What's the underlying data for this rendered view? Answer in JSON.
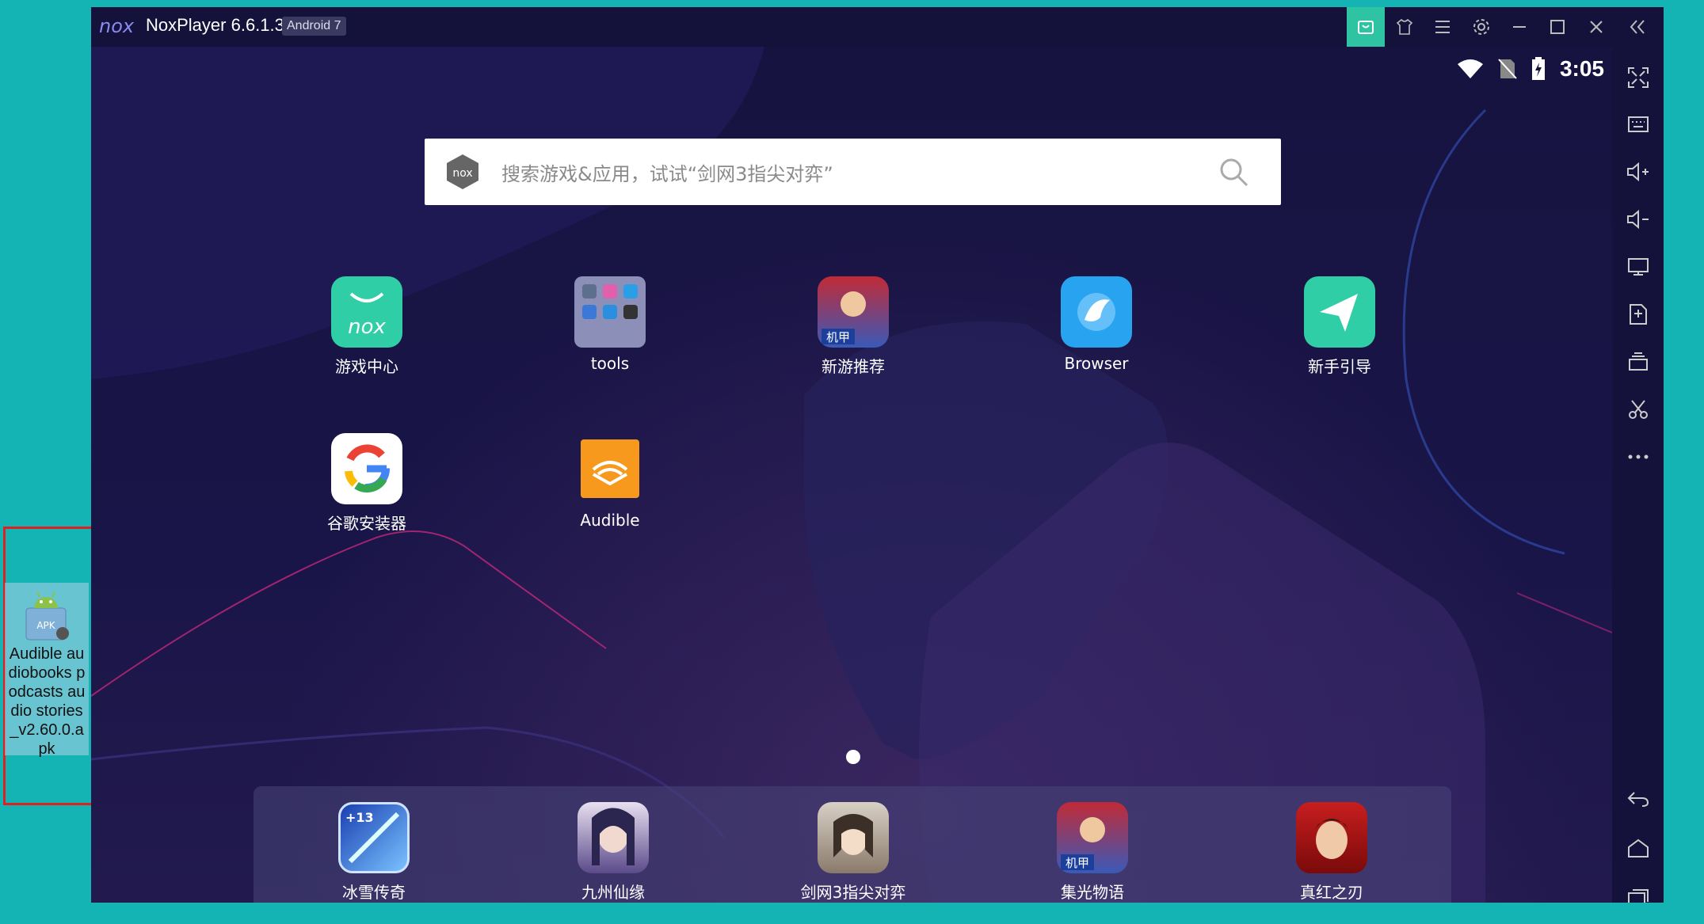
{
  "desktop": {
    "apk_file": {
      "icon": "apk-file-icon",
      "name": "Audible audiobooks podcasts audio stories_v2.60.0.apk"
    }
  },
  "window": {
    "title": "NoxPlayer 6.6.1.3",
    "android_badge": "Android 7",
    "title_buttons": [
      "store-icon",
      "home-icon",
      "menu-icon",
      "settings-icon",
      "minimize-icon",
      "maximize-icon",
      "close-icon",
      "collapse-icon"
    ]
  },
  "status_bar": {
    "time": "3:05"
  },
  "search": {
    "placeholder": "搜索游戏&应用，试试“剑网3指尖对弈”"
  },
  "apps": [
    {
      "label": "游戏中心"
    },
    {
      "label": "tools"
    },
    {
      "label": "新游推荐"
    },
    {
      "label": "Browser"
    },
    {
      "label": "新手引导"
    },
    {
      "label": "谷歌安装器"
    },
    {
      "label": "Audible"
    }
  ],
  "dock": [
    {
      "label": "冰雪传奇",
      "badge": "+13"
    },
    {
      "label": "九州仙缘"
    },
    {
      "label": "剑网3指尖对弈"
    },
    {
      "label": "集光物语",
      "badge": "机甲"
    },
    {
      "label": "真红之刃"
    }
  ],
  "app_badges": {
    "xinyou": "机甲"
  },
  "sidebar": [
    "fullscreen-icon",
    "keyboard-icon",
    "volume-up-icon",
    "volume-down-icon",
    "screen-icon",
    "apk-install-icon",
    "multi-instance-icon",
    "screenshot-icon",
    "more-icon",
    "back-icon",
    "home-icon",
    "recents-icon"
  ],
  "colors": {
    "accent": "#2ec3a3",
    "desktop_bg": "#14b4b4",
    "window_bg": "#15133a"
  }
}
